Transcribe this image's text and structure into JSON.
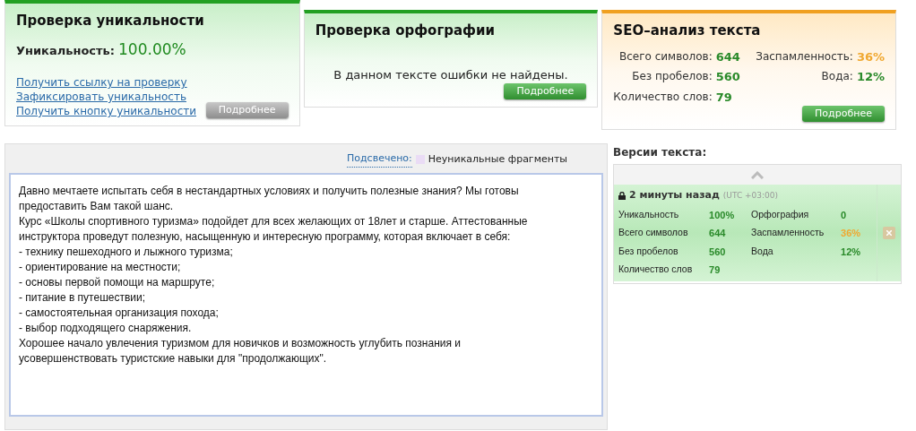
{
  "cards": [
    {
      "kind": "uniqueness",
      "title": "Проверка уникальности",
      "label": "Уникальность:",
      "value": "100.00%",
      "links": [
        "Получить ссылку на проверку",
        "Зафиксировать уникальность",
        "Получить кнопку уникальности"
      ],
      "button": {
        "label": "Подробнее",
        "disabled": true
      }
    },
    {
      "kind": "spelling",
      "title": "Проверка орфографии",
      "message": "В данном тексте ошибки не найдены.",
      "button": {
        "label": "Подробнее",
        "disabled": false
      }
    },
    {
      "kind": "seo",
      "title": "SEO–анализ текста",
      "stats": [
        {
          "label": "Всего символов:",
          "value": "644",
          "color": "#2a8a2a"
        },
        {
          "label": "Заспамленность:",
          "value": "36%",
          "color": "#f0a830"
        },
        {
          "label": "Без пробелов:",
          "value": "560",
          "color": "#2a8a2a"
        },
        {
          "label": "Вода:",
          "value": "12%",
          "color": "#2a8a2a"
        },
        {
          "label": "Количество слов:",
          "value": "79",
          "color": "#2a8a2a"
        }
      ],
      "button": {
        "label": "Подробнее",
        "disabled": false
      }
    }
  ],
  "editor": {
    "legend_link": "Подсвечено:",
    "legend_label": "Неуникальные фрагменты",
    "text": "Давно мечтаете испытать себя в нестандартных условиях и получить полезные знания? Мы готовы предоставить Вам такой шанс.\nКурс «Школы спортивного туризма» подойдет для всех желающих от 18лет и старше. Аттестованные инструктора проведут полезную, насыщенную и интересную программу, которая включает в себя:\n- технику пешеходного и лыжного туризма;\n- ориентирование на местности;\n- основы первой помощи на маршруте;\n- питание в путешествии;\n- самостоятельная организация похода;\n- выбор подходящего снаряжения.\nХорошее начало увлечения туризмом для новичков и возможность углубить познания и усовершенствовать туристские навыки для \"продолжающих\"."
  },
  "versions": {
    "title": "Версии текста:",
    "items": [
      {
        "time": "2 минуты назад",
        "timezone": "(UTC +03:00)",
        "locked": true,
        "selected": true,
        "stats": [
          {
            "label": "Уникальность",
            "value": "100%",
            "color": "#2a8a2a"
          },
          {
            "label": "Орфография",
            "value": "0",
            "color": "#2a8a2a"
          },
          {
            "label": "Всего символов",
            "value": "644",
            "color": "#2a8a2a"
          },
          {
            "label": "Заспамленность",
            "value": "36%",
            "color": "#f0a830"
          },
          {
            "label": "Без пробелов",
            "value": "560",
            "color": "#2a8a2a"
          },
          {
            "label": "Вода",
            "value": "12%",
            "color": "#2a8a2a"
          },
          {
            "label": "Количество слов",
            "value": "79",
            "color": "#2a8a2a"
          }
        ]
      }
    ]
  }
}
